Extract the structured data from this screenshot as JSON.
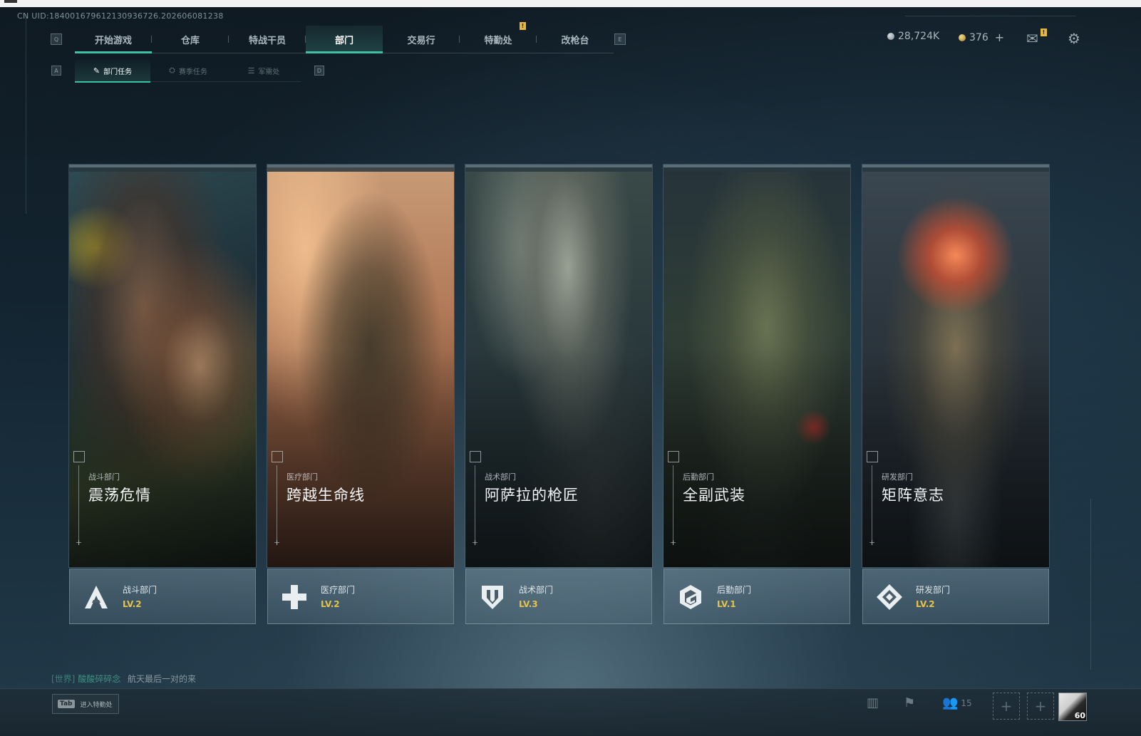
{
  "uid": "CN UID:1840016796121309367​26.202606081238",
  "keys": {
    "tab_left": "Q",
    "tab_right": "E",
    "sub_left": "A",
    "sub_right": "D"
  },
  "main_tabs": [
    {
      "label": "开始游戏",
      "active": false
    },
    {
      "label": "仓库",
      "active": false
    },
    {
      "label": "特战干员",
      "active": false
    },
    {
      "label": "部门",
      "active": true
    },
    {
      "label": "交易行",
      "active": false
    },
    {
      "label": "特勤处",
      "active": false,
      "alert": "!"
    },
    {
      "label": "改枪台",
      "active": false
    }
  ],
  "sub_tabs": [
    {
      "label": "部门任务",
      "active": true
    },
    {
      "label": "赛季任务",
      "active": false
    },
    {
      "label": "军需处",
      "active": false
    }
  ],
  "currency": {
    "silver": "28,724K",
    "gold": "376",
    "add": "+"
  },
  "mail_alert": "!",
  "cards": [
    {
      "sub": "战斗部门",
      "title": "震荡危情",
      "dept": "战斗部门",
      "level": "LV.2",
      "icon": "combat-emblem-icon"
    },
    {
      "sub": "医疗部门",
      "title": "跨越生命线",
      "dept": "医疗部门",
      "level": "LV.2",
      "icon": "medical-cross-icon"
    },
    {
      "sub": "战术部门",
      "title": "阿萨拉的枪匠",
      "dept": "战术部门",
      "level": "LV.3",
      "icon": "tactical-shield-icon"
    },
    {
      "sub": "后勤部门",
      "title": "全副武装",
      "dept": "后勤部门",
      "level": "LV.1",
      "icon": "logistics-hex-icon"
    },
    {
      "sub": "研发部门",
      "title": "矩阵意志",
      "dept": "研发部门",
      "level": "LV.2",
      "icon": "research-diamond-icon"
    }
  ],
  "chat": {
    "channel": "[世界]",
    "name": "酸酸碎碎念",
    "message": "航天最后一对的来"
  },
  "bottom": {
    "tab_key": "Tab",
    "tab_label": "进入特勤处",
    "friends_count": "15",
    "player_level": "60"
  },
  "colors": {
    "accent": "#3fbfa3",
    "level": "#e7c34a",
    "alert": "#e7b93a"
  }
}
